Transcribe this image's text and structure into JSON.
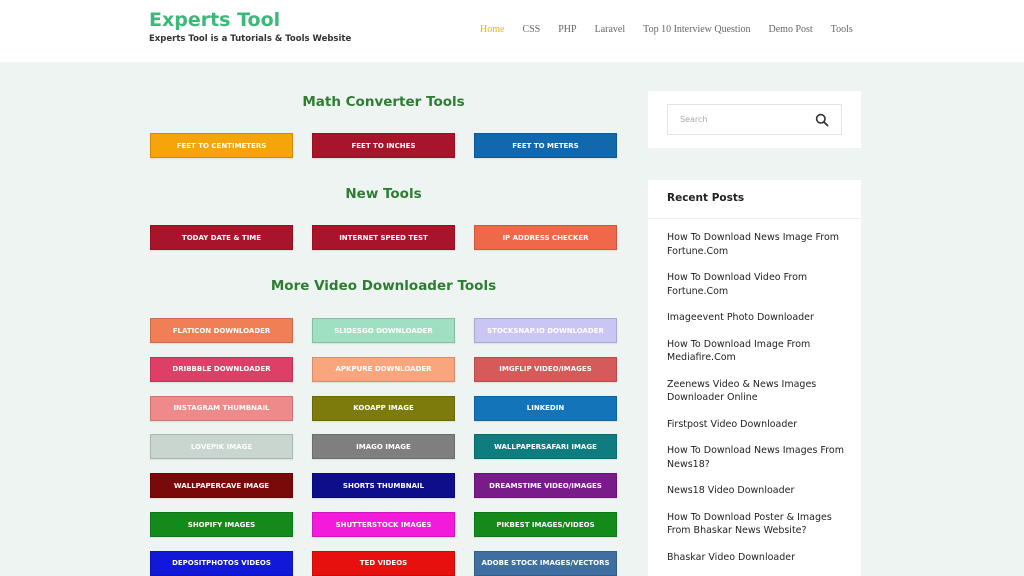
{
  "header": {
    "title": "Experts Tool",
    "tagline": "Experts Tool is a Tutorials & Tools Website",
    "nav": [
      "Home",
      "CSS",
      "PHP",
      "Laravel",
      "Top 10 Interview Question",
      "Demo Post",
      "Tools"
    ],
    "active_nav": "Home"
  },
  "sections": {
    "math": "Math Converter Tools",
    "new": "New Tools",
    "video": "More Video Downloader Tools"
  },
  "math_tools": [
    {
      "label": "FEET TO CENTIMETERS",
      "color": "#f5a50a"
    },
    {
      "label": "FEET TO INCHES",
      "color": "#a8142a"
    },
    {
      "label": "FEET TO METERS",
      "color": "#1168ad"
    }
  ],
  "new_tools": [
    {
      "label": "TODAY DATE & TIME",
      "color": "#a8142a"
    },
    {
      "label": "INTERNET SPEED TEST",
      "color": "#a8142a"
    },
    {
      "label": "IP ADDRESS CHECKER",
      "color": "#f0684a"
    }
  ],
  "video_tools": [
    {
      "label": "FLATICON DOWNLOADER",
      "color": "#f07f56"
    },
    {
      "label": "SLIDESGO DOWNLOADER",
      "color": "#9ee0bf"
    },
    {
      "label": "STOCKSNAP.IO DOWNLOADER",
      "color": "#c9c6f5"
    },
    {
      "label": "DRIBBBLE DOWNLOADER",
      "color": "#de3f67"
    },
    {
      "label": "APKPURE DOWNLOADER",
      "color": "#f9a67f"
    },
    {
      "label": "IMGFLIP VIDEO/IMAGES",
      "color": "#d75a5a"
    },
    {
      "label": "INSTAGRAM THUMBNAIL",
      "color": "#ef8a8a"
    },
    {
      "label": "KOOAPP IMAGE",
      "color": "#7c7b0b"
    },
    {
      "label": "LINKEDIN",
      "color": "#1374ba"
    },
    {
      "label": "LOVEPIK IMAGE",
      "color": "#c9d6cf"
    },
    {
      "label": "IMAGO IMAGE",
      "color": "#7f7f7f"
    },
    {
      "label": "WALLPAPERSAFARI IMAGE",
      "color": "#0f7d80"
    },
    {
      "label": "WALLPAPERCAVE IMAGE",
      "color": "#7a0a0a"
    },
    {
      "label": "SHORTS THUMBNAIL",
      "color": "#0e0e8a"
    },
    {
      "label": "DREAMSTIME VIDEO/IMAGES",
      "color": "#7a1b8a"
    },
    {
      "label": "SHOPIFY IMAGES",
      "color": "#138a1a"
    },
    {
      "label": "SHUTTERSTOCK IMAGES",
      "color": "#f41adc"
    },
    {
      "label": "PIKBEST IMAGES/VIDEOS",
      "color": "#138a1a"
    },
    {
      "label": "DEPOSITPHOTOS VIDEOS",
      "color": "#1118d8"
    },
    {
      "label": "TED VIDEOS",
      "color": "#e80f0f"
    },
    {
      "label": "ADOBE STOCK IMAGES/VECTORS",
      "color": "#3f6fa0"
    }
  ],
  "sidebar": {
    "search_placeholder": "Search",
    "recent_title": "Recent Posts",
    "recent_posts": [
      "How To Download News Image From Fortune.Com",
      "How To Download Video From Fortune.Com",
      "Imageevent Photo Downloader",
      "How To Download Image From Mediafire.Com",
      "Zeenews Video & News Images Downloader Online",
      "Firstpost Video Downloader",
      "How To Download News Images From News18?",
      "News18 Video Downloader",
      "How To Download Poster & Images From Bhaskar News Website?",
      "Bhaskar Video Downloader"
    ]
  },
  "colors": {
    "brand": "#3cb878",
    "nav_active": "#e8b800",
    "section_heading": "#2e7d32",
    "page_bg": "#eef4f1"
  }
}
